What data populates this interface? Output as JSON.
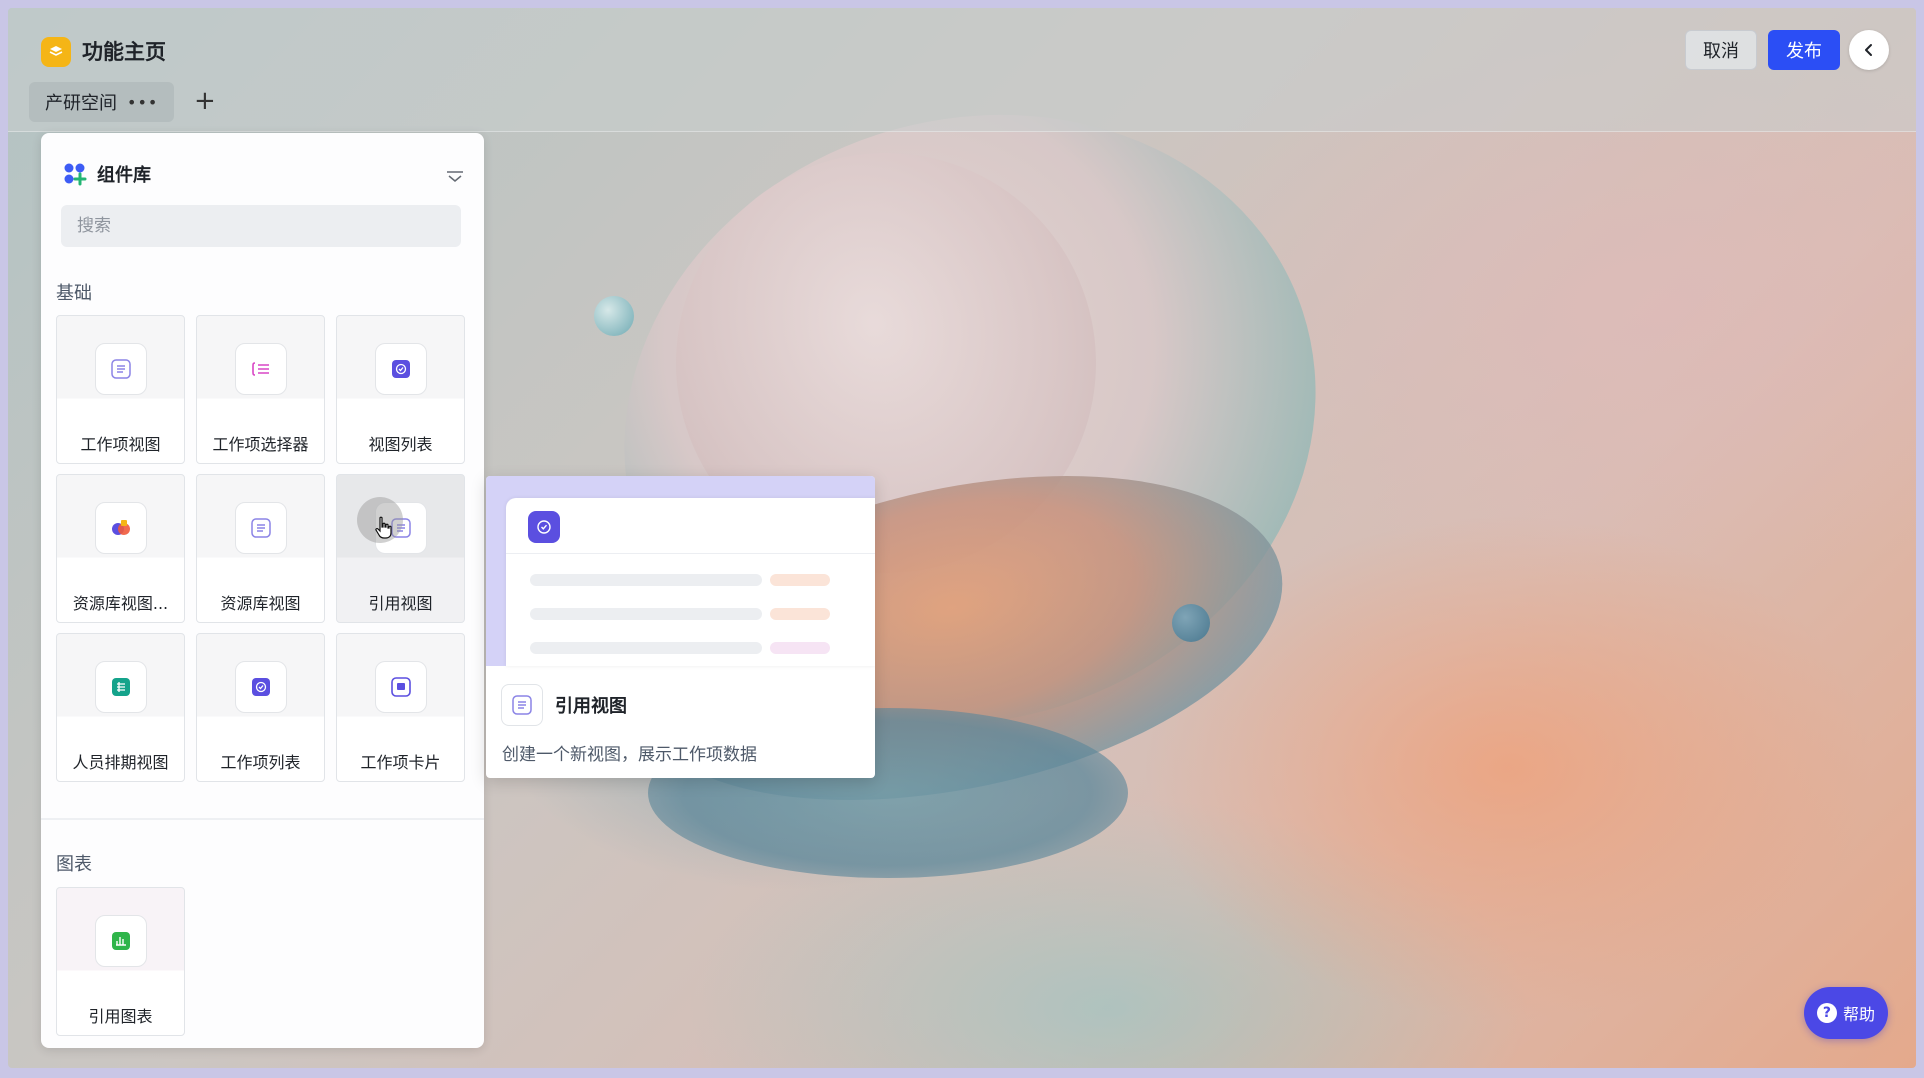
{
  "header": {
    "title": "功能主页",
    "tab_label": "产研空间",
    "tab_more": "•••",
    "add_tab": "+",
    "cancel_label": "取消",
    "publish_label": "发布"
  },
  "panel": {
    "title": "组件库",
    "search_placeholder": "搜索",
    "sections": [
      {
        "label": "基础",
        "items": [
          {
            "label": "工作项视图",
            "icon": "list-icon"
          },
          {
            "label": "工作项选择器",
            "icon": "selector-icon"
          },
          {
            "label": "视图列表",
            "icon": "check-badge-icon"
          },
          {
            "label": "资源库视图...",
            "icon": "resource-library-icon"
          },
          {
            "label": "资源库视图",
            "icon": "list-icon"
          },
          {
            "label": "引用视图",
            "icon": "list-icon"
          },
          {
            "label": "人员排期视图",
            "icon": "schedule-icon"
          },
          {
            "label": "工作项列表",
            "icon": "check-badge-icon"
          },
          {
            "label": "工作项卡片",
            "icon": "card-icon"
          }
        ]
      },
      {
        "label": "图表",
        "items": [
          {
            "label": "引用图表",
            "icon": "chart-icon"
          }
        ]
      }
    ]
  },
  "popover": {
    "title": "引用视图",
    "description": "创建一个新视图，展示工作项数据"
  },
  "help": {
    "label": "帮助",
    "icon_glyph": "?"
  },
  "colors": {
    "primary": "#2b4ef5",
    "accent_purple": "#5b4fe0",
    "app_logo": "#f5b516",
    "help": "#4b48e6"
  }
}
